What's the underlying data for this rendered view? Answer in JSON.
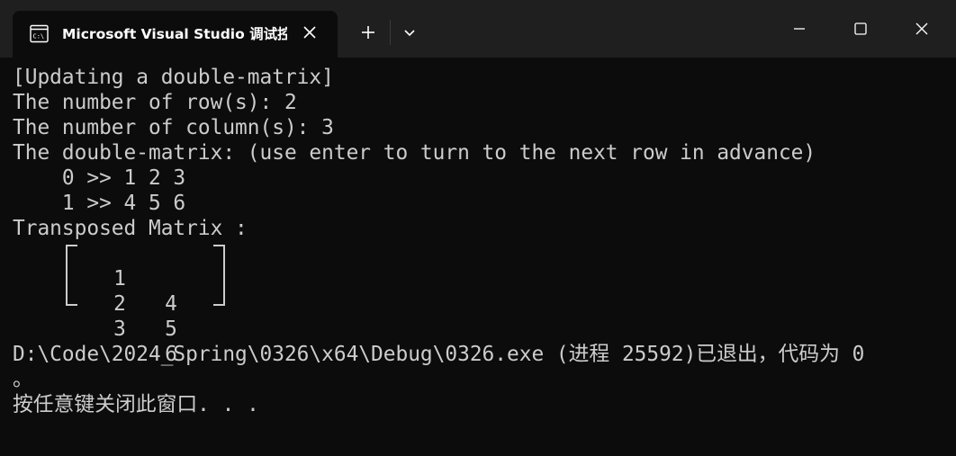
{
  "window": {
    "tab_title": "Microsoft Visual Studio 调试控制台",
    "new_tab_label": "+",
    "icons": {
      "tab": "console-app-icon",
      "close_tab": "close-icon",
      "new_tab": "plus-icon",
      "dropdown": "chevron-down-icon",
      "minimize": "minimize-icon",
      "maximize": "maximize-icon",
      "close": "close-icon"
    },
    "colors": {
      "titlebar": "#1f1f1f",
      "background": "#0c0c0c",
      "text": "#cccccc"
    }
  },
  "console": {
    "lines_before": [
      "[Updating a double-matrix]",
      "The number of row(s): 2",
      "The number of column(s): 3",
      "The double-matrix: (use enter to turn to the next row in advance)",
      "    0 >> 1 2 3",
      "    1 >> 4 5 6",
      "Transposed Matrix :"
    ],
    "matrix": [
      [
        "1",
        "4"
      ],
      [
        "2",
        "5"
      ],
      [
        "3",
        "6"
      ]
    ],
    "lines_after": [
      "",
      "D:\\Code\\2024_Spring\\0326\\x64\\Debug\\0326.exe (进程 25592)已退出，代码为 0",
      "。",
      "按任意键关闭此窗口. . ."
    ]
  }
}
